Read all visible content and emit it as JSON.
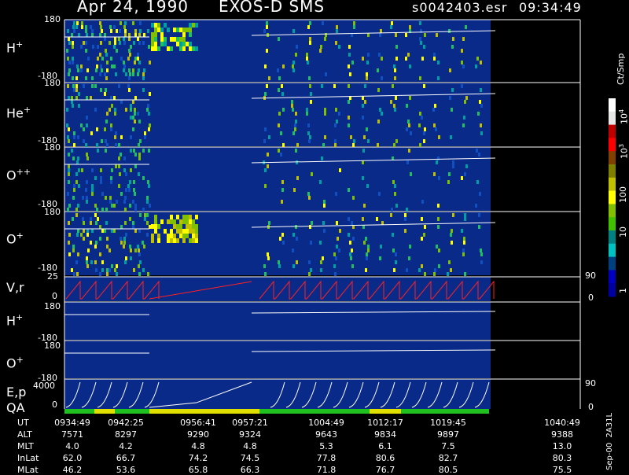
{
  "header": {
    "date": "Apr 24, 1990",
    "mission": "EXOS-D SMS",
    "file": "s0042403.esr",
    "time": "09:34:49"
  },
  "panels": [
    {
      "name": "H",
      "sup": "+",
      "ytop": "180",
      "ybot": "-180"
    },
    {
      "name": "He",
      "sup": "+",
      "ytop": "180",
      "ybot": "-180"
    },
    {
      "name": "O",
      "sup": "++",
      "ytop": "180",
      "ybot": "-180"
    },
    {
      "name": "O",
      "sup": "+",
      "ytop": "180",
      "ybot": "-180"
    }
  ],
  "vr_panel": {
    "label": "V,r",
    "ytop": "25",
    "ybot": "0",
    "right_top": "90",
    "right_bot": "0"
  },
  "h2_panel": {
    "name": "H",
    "sup": "+",
    "ytop": "180",
    "ybot": "-180"
  },
  "o2_panel": {
    "name": "O",
    "sup": "+",
    "ytop": "180",
    "ybot": "-180"
  },
  "ep_panel": {
    "label": "E,p",
    "label2": "QA",
    "ytop": "4000",
    "ybot": "0",
    "right_top": "90",
    "right_bot": "0"
  },
  "colorbar": {
    "unit": "Ct/Smp",
    "ticks": [
      "10",
      "10",
      "100",
      "10",
      "10",
      "1"
    ],
    "tick_exps": [
      "4",
      "3",
      "",
      "",
      "",
      ""
    ],
    "colors": [
      "#ffffff",
      "#e8e8e8",
      "#c00000",
      "#ff0000",
      "#804000",
      "#808000",
      "#c0c000",
      "#ffff00",
      "#80c000",
      "#40c000",
      "#008080",
      "#00c0c0",
      "#004080",
      "#0000c0",
      "#0000a0"
    ]
  },
  "footer": {
    "rows": [
      "UT",
      "ALT",
      "MLT",
      "InLat",
      "MLat"
    ],
    "columns": [
      [
        "0934:49",
        "7571",
        "4.0",
        "62.0",
        "46.2"
      ],
      [
        "0942:25",
        "8297",
        "4.2",
        "66.7",
        "53.6"
      ],
      [
        "0956:41",
        "9290",
        "4.8",
        "74.2",
        "65.8"
      ],
      [
        "0957:21",
        "9324",
        "4.8",
        "74.5",
        "66.3"
      ],
      [
        "1004:49",
        "9643",
        "5.3",
        "77.8",
        "71.8"
      ],
      [
        "1012:17",
        "9834",
        "6.1",
        "80.6",
        "76.7"
      ],
      [
        "1019:45",
        "9897",
        "7.5",
        "82.7",
        "80.5"
      ],
      [
        "1040:49",
        "9388",
        "13.0",
        "80.3",
        "75.5"
      ]
    ],
    "side_label": "Sep-00  2A31L"
  },
  "chart_data": {
    "type": "heatmap",
    "title": "Apr 24, 1990   EXOS-D SMS",
    "x_ticks": [
      "0934:49",
      "0942:25",
      "0956:41",
      "0957:21",
      "1004:49",
      "1012:17",
      "1019:45",
      "1040:49"
    ],
    "panels": [
      "H+",
      "He+",
      "O++",
      "O+",
      "V,r",
      "H+",
      "O+",
      "E,p / QA"
    ],
    "y_ranges": {
      "pitch": [
        -180,
        180
      ],
      "V,r": [
        0,
        25
      ],
      "E,p": [
        0,
        4000
      ]
    },
    "color_scale": {
      "unit": "Ct/Smp",
      "range": [
        1,
        10000
      ],
      "log": true
    }
  }
}
